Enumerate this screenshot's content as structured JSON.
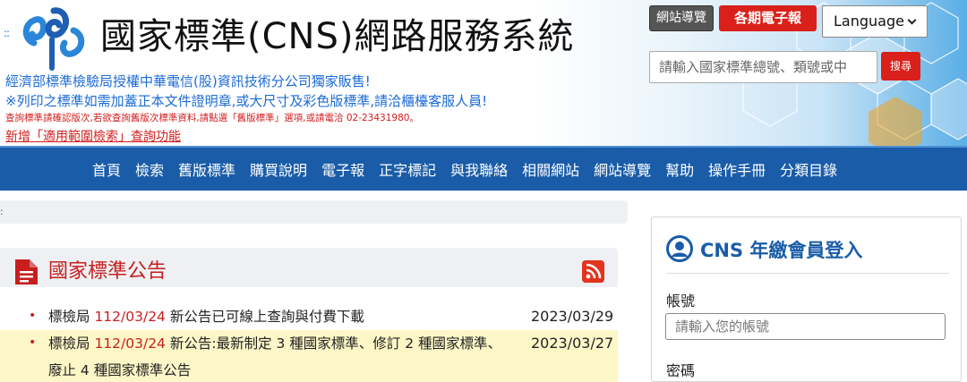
{
  "header": {
    "ellipsis": "::",
    "site_title": "國家標準(CNS)網路服務系統",
    "notices": [
      "經濟部標準檢驗局授權中華電信(股)資訊技術分公司獨家販售!",
      "※列印之標準如需加蓋正本文件證明章,或大尺寸及彩色版標準,請洽櫃檯客服人員!",
      "查詢標準請確認版次,若欲查詢舊版次標準資料,請點選「舊版標準」選項,或請電洽 02-23431980。",
      "新增「適用範圍檢索」查詢功能"
    ],
    "guide_button": "網站導覽",
    "epaper_button": "各期電子報",
    "language_button": "Language",
    "search_placeholder": "請輸入國家標準總號、類號或中",
    "search_button": "搜尋"
  },
  "nav": {
    "items": [
      "首頁",
      "檢索",
      "舊版標準",
      "購買說明",
      "電子報",
      "正字標記",
      "與我聯絡",
      "相關網站",
      "網站導覽",
      "幫助",
      "操作手冊",
      "分類目錄"
    ]
  },
  "breadcrumb": {
    "marker": ":"
  },
  "announcements": {
    "title": "國家標準公告",
    "items": [
      {
        "prefix": "標檢局 ",
        "date_red": "112/03/24",
        "text": " 新公告已可線上查詢與付費下載",
        "date": "2023/03/29"
      },
      {
        "prefix": "標檢局 ",
        "date_red": "112/03/24",
        "text": " 新公告:最新制定 3 種國家標準、修訂 2 種國家標準、廢止 4 種國家標準公告",
        "date": "2023/03/27"
      }
    ]
  },
  "login": {
    "title": "CNS 年繳會員登入",
    "account_label": "帳號",
    "account_placeholder": "請輸入您的帳號",
    "password_label": "密碼"
  },
  "colors": {
    "nav_blue": "#1a5ca8",
    "accent_red": "#d9201a",
    "highlight_yellow": "#fdf7c8"
  }
}
